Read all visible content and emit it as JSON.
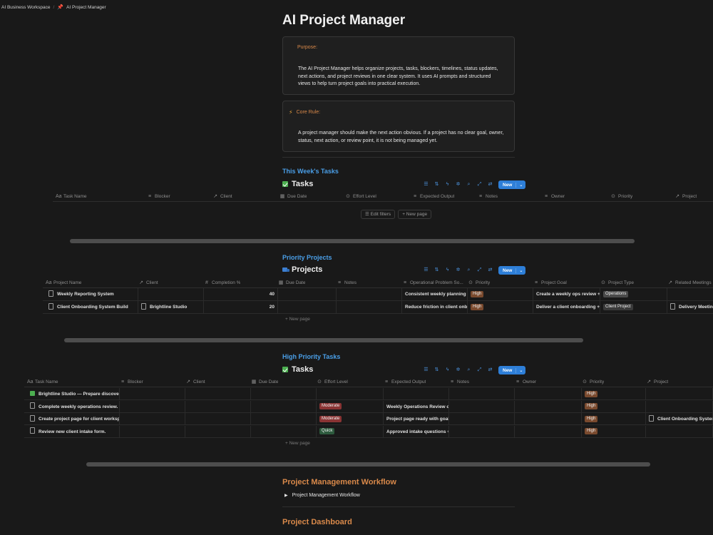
{
  "breadcrumb": {
    "workspace": "AI Business Workspace",
    "separator": "/",
    "page": "AI Project Manager"
  },
  "page_title": "AI Project Manager",
  "callouts": {
    "purpose": {
      "label": "Purpose:",
      "body": "The AI Project Manager helps organize projects, tasks, blockers, timelines, status updates, next actions, and project reviews in one clear system. It uses AI prompts and structured views to help turn project goals into practical execution."
    },
    "core_rule": {
      "label": "Core Rule:",
      "body": "A project manager should make the next action obvious. If a project has no clear goal, owner, status, next action, or review point, it is not being managed yet."
    }
  },
  "icons": {
    "pin": "pin-icon",
    "bolt": "lightning-icon",
    "filter": "filter-icon",
    "sort": "sort-icon",
    "automation": "lightning-icon",
    "ai": "sparkle-icon",
    "search": "search-icon",
    "expand": "expand-icon",
    "settings": "sliders-icon",
    "doc": "document-icon"
  },
  "toolbar": {
    "new_label": "New",
    "caret": "⌄"
  },
  "weekly": {
    "heading": "This Week's Tasks",
    "db_title": "Tasks",
    "columns": [
      {
        "icon": "Aa",
        "label": "Task Name"
      },
      {
        "icon": "≡",
        "label": "Blocker"
      },
      {
        "icon": "↗",
        "label": "Client"
      },
      {
        "icon": "▦",
        "label": "Due Date"
      },
      {
        "icon": "⊙",
        "label": "Effort Level"
      },
      {
        "icon": "≡",
        "label": "Expected Output"
      },
      {
        "icon": "≡",
        "label": "Notes"
      },
      {
        "icon": "≡",
        "label": "Owner"
      },
      {
        "icon": "⊙",
        "label": "Priority"
      },
      {
        "icon": "↗",
        "label": "Project"
      }
    ],
    "edit_filters": "Edit filters",
    "new_page": "+ New page"
  },
  "projects": {
    "heading": "Priority Projects",
    "db_title": "Projects",
    "columns": [
      {
        "icon": "Aa",
        "label": "Project Name"
      },
      {
        "icon": "↗",
        "label": "Client"
      },
      {
        "icon": "#",
        "label": "Completion %"
      },
      {
        "icon": "▦",
        "label": "Due Date"
      },
      {
        "icon": "≡",
        "label": "Notes"
      },
      {
        "icon": "≡",
        "label": "Operational Problem So..."
      },
      {
        "icon": "⊙",
        "label": "Priority"
      },
      {
        "icon": "≡",
        "label": "Project Goal"
      },
      {
        "icon": "⊙",
        "label": "Project Type"
      },
      {
        "icon": "↗",
        "label": "Related Meetings"
      }
    ],
    "rows": [
      {
        "name": "Weekly Reporting System",
        "client": "",
        "completion": "40",
        "due": "",
        "notes": "",
        "problem": "Consistent weekly planning and",
        "priority": "High",
        "goal": "Create a weekly ops review + re",
        "type": "Operations",
        "meetings": ""
      },
      {
        "name": "Client Onboarding System Build",
        "client": "Brightline Studio",
        "completion": "20",
        "due": "",
        "notes": "",
        "problem": "Reduce friction in client onboar",
        "priority": "High",
        "goal": "Deliver a client onboarding + d",
        "type": "Client Project",
        "meetings": "Delivery Meeting -"
      }
    ],
    "new_page": "+ New page"
  },
  "high_tasks": {
    "heading": "High Priority Tasks",
    "db_title": "Tasks",
    "columns": [
      {
        "icon": "Aa",
        "label": "Task Name"
      },
      {
        "icon": "≡",
        "label": "Blocker"
      },
      {
        "icon": "↗",
        "label": "Client"
      },
      {
        "icon": "▦",
        "label": "Due Date"
      },
      {
        "icon": "⊙",
        "label": "Effort Level"
      },
      {
        "icon": "≡",
        "label": "Expected Output"
      },
      {
        "icon": "≡",
        "label": "Notes"
      },
      {
        "icon": "≡",
        "label": "Owner"
      },
      {
        "icon": "⊙",
        "label": "Priority"
      },
      {
        "icon": "↗",
        "label": "Project"
      }
    ],
    "rows": [
      {
        "name": "Brightline Studio — Prepare discovery c",
        "checked": true,
        "effort": "",
        "effort_class": "",
        "output": "",
        "priority": "High",
        "project": ""
      },
      {
        "name": "Complete weekly operations review.",
        "checked": false,
        "effort": "Moderate",
        "effort_class": "moderate",
        "output": "Weekly Operations Review com",
        "priority": "High",
        "project": ""
      },
      {
        "name": "Create project page for client workspac",
        "checked": false,
        "effort": "Moderate",
        "effort_class": "moderate",
        "output": "Project page ready with goal, ri",
        "priority": "High",
        "project": "Client Onboarding System"
      },
      {
        "name": "Review new client intake form.",
        "checked": false,
        "effort": "Quick",
        "effort_class": "quick",
        "output": "Approved intake questions + n",
        "priority": "High",
        "project": ""
      }
    ],
    "new_page": "+ New page"
  },
  "workflow": {
    "heading": "Project Management Workflow",
    "toggle_label": "Project Management Workflow"
  },
  "dashboard": {
    "heading": "Project Dashboard"
  },
  "colors": {
    "background": "#191919",
    "accent_blue": "#4a9fe8",
    "accent_orange": "#d9894a",
    "button_blue": "#2e7fd8"
  }
}
